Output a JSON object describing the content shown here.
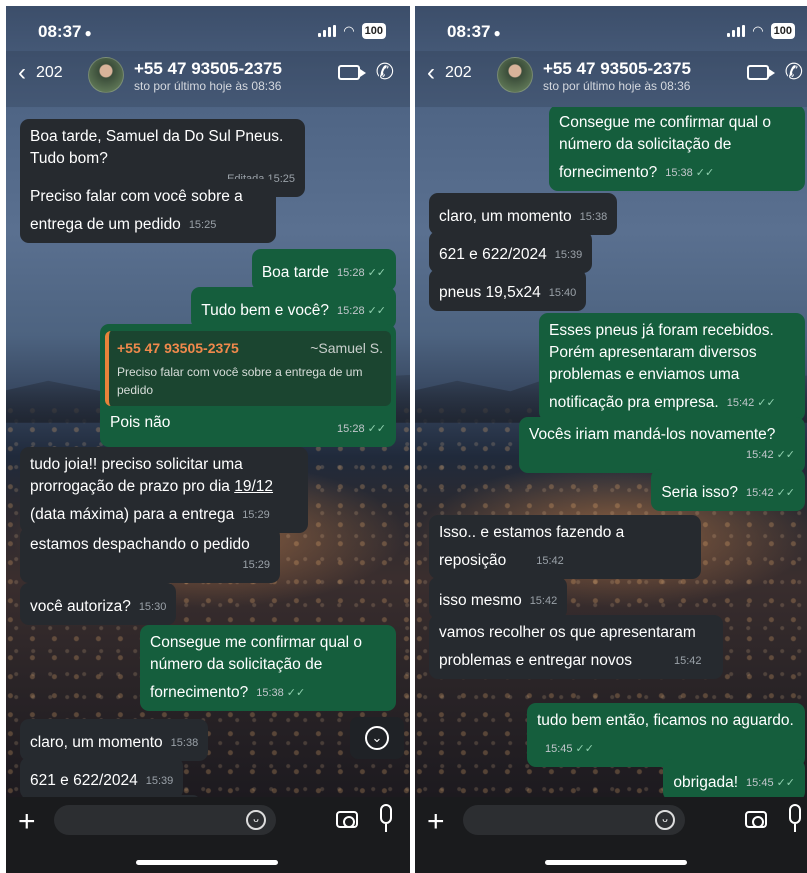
{
  "status": {
    "time": "08:37",
    "battery": "100"
  },
  "header": {
    "back_count": "202",
    "contact_name": "+55 47 93505-2375",
    "contact_status": "sto por último hoje às 08:36"
  },
  "left_messages": [
    {
      "text": "Boa tarde, Samuel da Do Sul Pneus. Tudo bom?",
      "edited": "Editada",
      "time": "15:25"
    },
    {
      "text": "Preciso falar com você sobre a entrega de um pedido",
      "time": "15:25"
    },
    {
      "text": "Boa tarde",
      "time": "15:28"
    },
    {
      "text": "Tudo bem e você?",
      "time": "15:28"
    },
    {
      "quote_name": "+55 47 93505-2375",
      "quote_alias": "~Samuel S.",
      "quote_text": "Preciso falar com você sobre a entrega de um pedido",
      "text": "Pois não",
      "time": "15:28"
    },
    {
      "text_a": "tudo joia!! preciso solicitar uma prorrogação de prazo pro dia ",
      "text_date": "19/12",
      "text_b": " (data máxima) para a entrega",
      "time": "15:29"
    },
    {
      "text": "estamos despachando o pedido",
      "time": "15:29"
    },
    {
      "text": "você autoriza?",
      "time": "15:30"
    },
    {
      "text": "Consegue me confirmar qual o número da solicitação de fornecimento?",
      "time": "15:38"
    },
    {
      "text": "claro, um momento",
      "time": "15:38"
    },
    {
      "text": "621 e 622/2024",
      "time": "15:39"
    }
  ],
  "right_messages": [
    {
      "text": "Consegue me confirmar qual o número da solicitação de fornecimento?",
      "time": "15:38"
    },
    {
      "text": "claro, um momento",
      "time": "15:38"
    },
    {
      "text": "621 e 622/2024",
      "time": "15:39"
    },
    {
      "text": "pneus 19,5x24",
      "time": "15:40"
    },
    {
      "text": "Esses pneus já foram recebidos. Porém apresentaram diversos problemas e enviamos uma notificação pra empresa.",
      "time": "15:42"
    },
    {
      "text": "Vocês iriam mandá-los novamente?",
      "time": "15:42"
    },
    {
      "text": "Seria isso?",
      "time": "15:42"
    },
    {
      "text": "Isso.. e estamos fazendo a reposição",
      "time": "15:42"
    },
    {
      "text": "isso mesmo",
      "time": "15:42"
    },
    {
      "text": "vamos recolher os que apresentaram problemas e entregar novos",
      "time": "15:42"
    },
    {
      "text": "tudo bem então, ficamos no aguardo.",
      "time": "15:45"
    },
    {
      "text": "obrigada!",
      "time": "15:45"
    }
  ],
  "icons": {
    "read_ticks": "✓✓",
    "back": "‹",
    "plus": "+",
    "scroll_down": "⌄"
  }
}
